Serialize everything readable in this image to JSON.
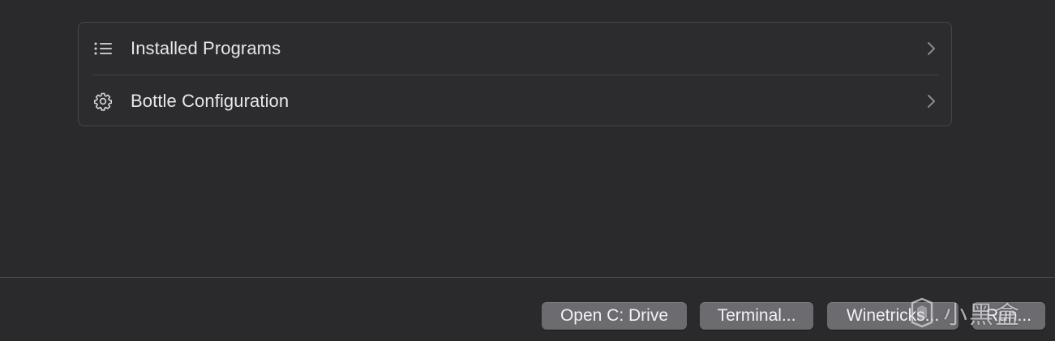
{
  "settings_group": {
    "rows": [
      {
        "label": "Installed Programs",
        "icon": "list-icon"
      },
      {
        "label": "Bottle Configuration",
        "icon": "gear-icon"
      }
    ]
  },
  "footer": {
    "buttons": [
      {
        "label": "Open C: Drive"
      },
      {
        "label": "Terminal..."
      },
      {
        "label": "Winetricks..."
      },
      {
        "label": "Run..."
      }
    ]
  },
  "watermark": {
    "text": "小黑盒",
    "icon": "heybox-logo-icon"
  },
  "colors": {
    "background": "#2a2a2d",
    "group_background": "#2c2c2f",
    "button_background": "#6b6b70",
    "text": "#e8e8ea"
  }
}
